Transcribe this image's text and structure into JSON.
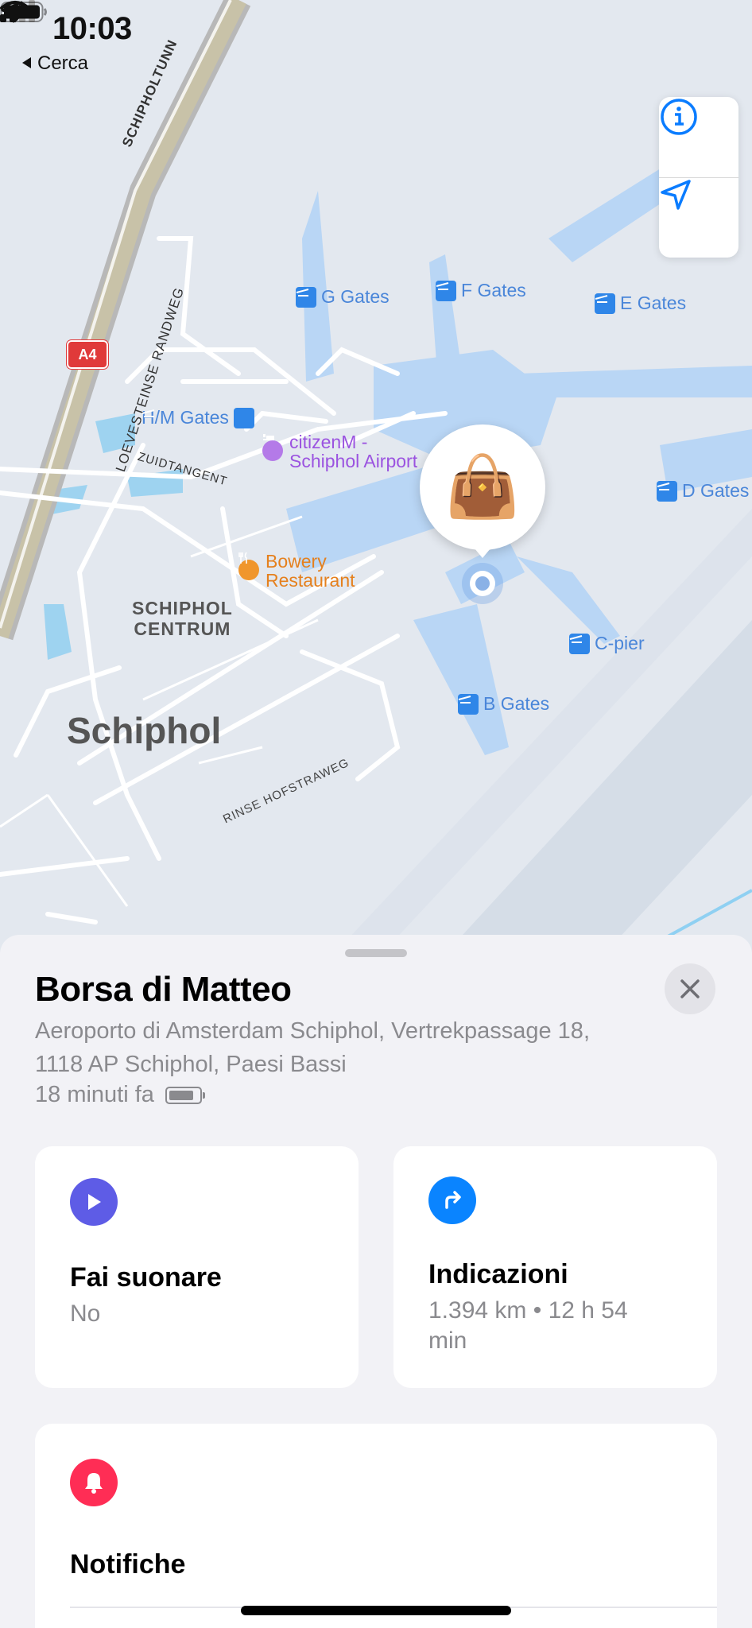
{
  "status_bar": {
    "time": "10:03",
    "back_label": "Cerca"
  },
  "map": {
    "gates": [
      "G Gates",
      "F Gates",
      "E Gates",
      "H/M Gates",
      "D Gates",
      "C-pier",
      "B Gates"
    ],
    "poi_hotel": {
      "line1": "citizenM -",
      "line2": "Schiphol Airport"
    },
    "poi_restaurant": {
      "line1": "Bowery",
      "line2": "Restaurant"
    },
    "area_label": {
      "line1": "SCHIPHOL",
      "line2": "CENTRUM"
    },
    "city_label": "Schiphol",
    "roads": [
      "SCHIPHOLTUNN",
      "LOEVESTEINSE RANDWEG",
      "ZUIDTANGENT",
      "RINSE HOFSTRAWEG"
    ],
    "highway_shield": "A4",
    "item_emoji": "👜"
  },
  "sheet": {
    "title": "Borsa di Matteo",
    "address_line1": "Aeroporto di Amsterdam Schiphol, Vertrekpassage 18,",
    "address_line2": "1118 AP Schiphol, Paesi Bassi",
    "last_seen": "18 minuti fa",
    "play_sound": {
      "title": "Fai suonare",
      "status": "No",
      "color": "#5e5ce6"
    },
    "directions": {
      "title": "Indicazioni",
      "line1": "1.394 km • 12 h 54",
      "line2": "min",
      "color": "#0a84ff"
    },
    "notifications": {
      "title": "Notifiche",
      "color": "#ff2d55"
    }
  }
}
